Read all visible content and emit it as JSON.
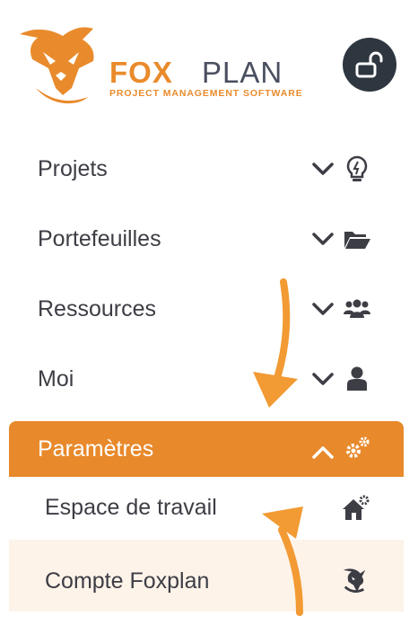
{
  "brand": {
    "name_part1": "FOX",
    "name_part2": "PLAN",
    "tagline": "PROJECT MANAGEMENT SOFTWARE"
  },
  "menu": {
    "items": [
      {
        "label": "Projets",
        "icon": "lightbulb-icon"
      },
      {
        "label": "Portefeuilles",
        "icon": "folder-open-icon"
      },
      {
        "label": "Ressources",
        "icon": "users-icon"
      },
      {
        "label": "Moi",
        "icon": "user-icon"
      },
      {
        "label": "Paramètres",
        "icon": "gears-icon",
        "expanded": true
      }
    ],
    "submenu": [
      {
        "label": "Espace de travail",
        "icon": "house-gear-icon"
      },
      {
        "label": "Compte Foxplan",
        "icon": "fox-logo-icon"
      }
    ]
  },
  "colors": {
    "accent": "#e8892b",
    "dark": "#2e3640",
    "text": "#3d3d45",
    "submenu_tint": "#fdf3e9"
  }
}
